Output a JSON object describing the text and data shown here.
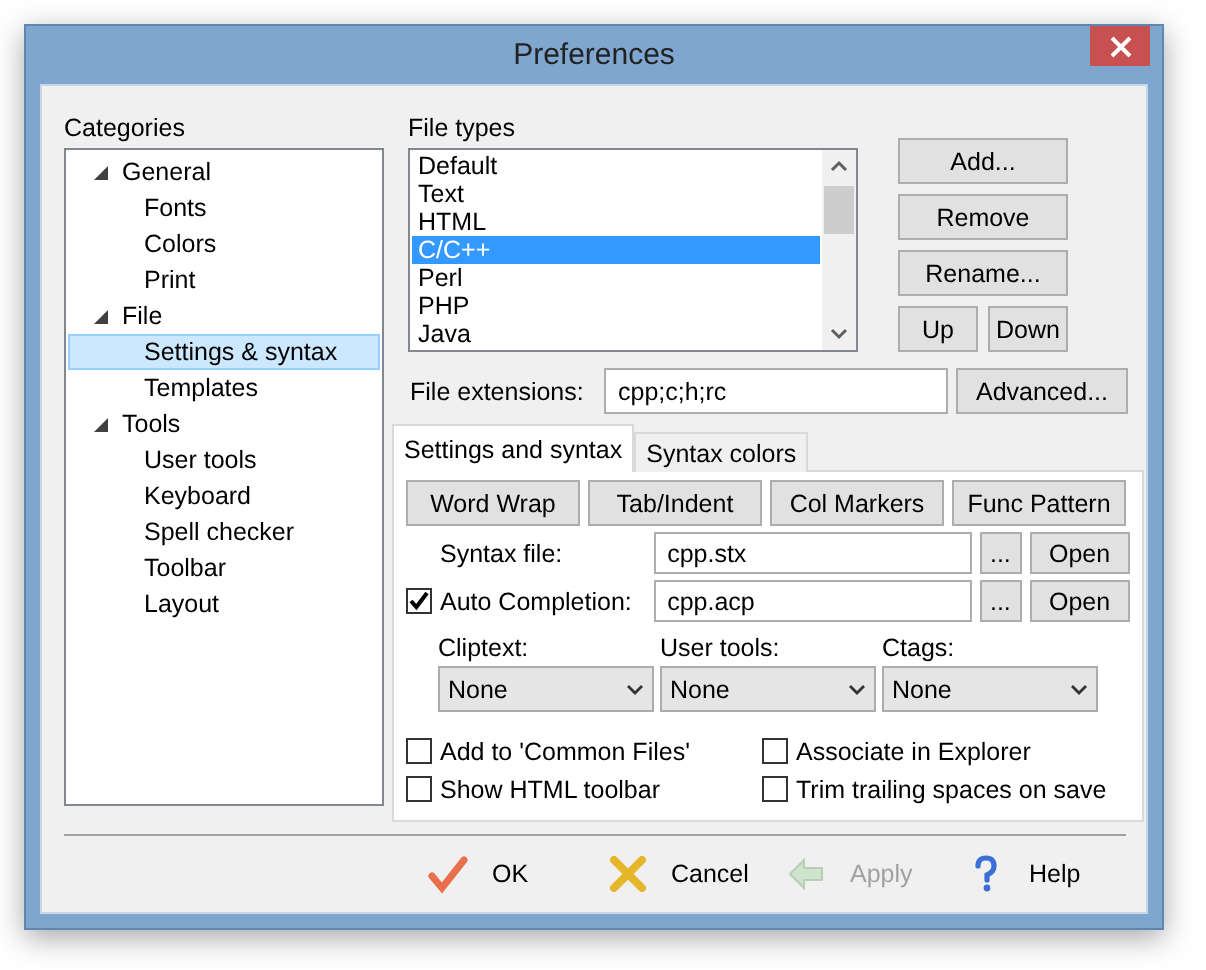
{
  "window": {
    "title": "Preferences"
  },
  "categories": {
    "label": "Categories",
    "tree": [
      {
        "label": "General",
        "expanded": true,
        "selected": false,
        "children": [
          {
            "label": "Fonts",
            "selected": false
          },
          {
            "label": "Colors",
            "selected": false
          },
          {
            "label": "Print",
            "selected": false
          }
        ]
      },
      {
        "label": "File",
        "expanded": true,
        "selected": false,
        "children": [
          {
            "label": "Settings & syntax",
            "selected": true
          },
          {
            "label": "Templates",
            "selected": false
          }
        ]
      },
      {
        "label": "Tools",
        "expanded": true,
        "selected": false,
        "children": [
          {
            "label": "User tools",
            "selected": false
          },
          {
            "label": "Keyboard",
            "selected": false
          },
          {
            "label": "Spell checker",
            "selected": false
          },
          {
            "label": "Toolbar",
            "selected": false
          },
          {
            "label": "Layout",
            "selected": false
          }
        ]
      }
    ]
  },
  "file_types": {
    "label": "File types",
    "items": [
      {
        "label": "Default",
        "selected": false
      },
      {
        "label": "Text",
        "selected": false
      },
      {
        "label": "HTML",
        "selected": false
      },
      {
        "label": "C/C++",
        "selected": true
      },
      {
        "label": "Perl",
        "selected": false
      },
      {
        "label": "PHP",
        "selected": false
      },
      {
        "label": "Java",
        "selected": false
      }
    ]
  },
  "file_type_buttons": [
    "Add...",
    "Remove",
    "Rename..."
  ],
  "order_buttons": [
    "Up",
    "Down"
  ],
  "file_extensions": {
    "label": "File extensions:",
    "value": "cpp;c;h;rc",
    "button": "Advanced..."
  },
  "tabs": [
    {
      "label": "Settings and syntax",
      "selected": true
    },
    {
      "label": "Syntax colors",
      "selected": false
    }
  ],
  "tool_buttons": [
    "Word Wrap",
    "Tab/Indent",
    "Col Markers",
    "Func Pattern"
  ],
  "files": [
    {
      "kind": "label",
      "label": "Syntax file:",
      "value": "cpp.stx",
      "browse": "...",
      "open": "Open"
    },
    {
      "kind": "checkbox",
      "label": "Auto Completion:",
      "checked": true,
      "value": "cpp.acp",
      "browse": "...",
      "open": "Open"
    }
  ],
  "dropdowns": [
    {
      "label": "Cliptext:",
      "value": "None"
    },
    {
      "label": "User tools:",
      "value": "None"
    },
    {
      "label": "Ctags:",
      "value": "None"
    }
  ],
  "options": [
    {
      "label": "Add to 'Common Files'",
      "checked": false
    },
    {
      "label": "Associate in Explorer",
      "checked": false
    },
    {
      "label": "Show HTML toolbar",
      "checked": false
    },
    {
      "label": "Trim trailing spaces on save",
      "checked": false
    }
  ],
  "footer": [
    {
      "kind": "ok",
      "label": "OK",
      "disabled": false
    },
    {
      "kind": "cancel",
      "label": "Cancel",
      "disabled": false
    },
    {
      "kind": "apply",
      "label": "Apply",
      "disabled": true
    },
    {
      "kind": "help",
      "label": "Help",
      "disabled": false
    }
  ]
}
